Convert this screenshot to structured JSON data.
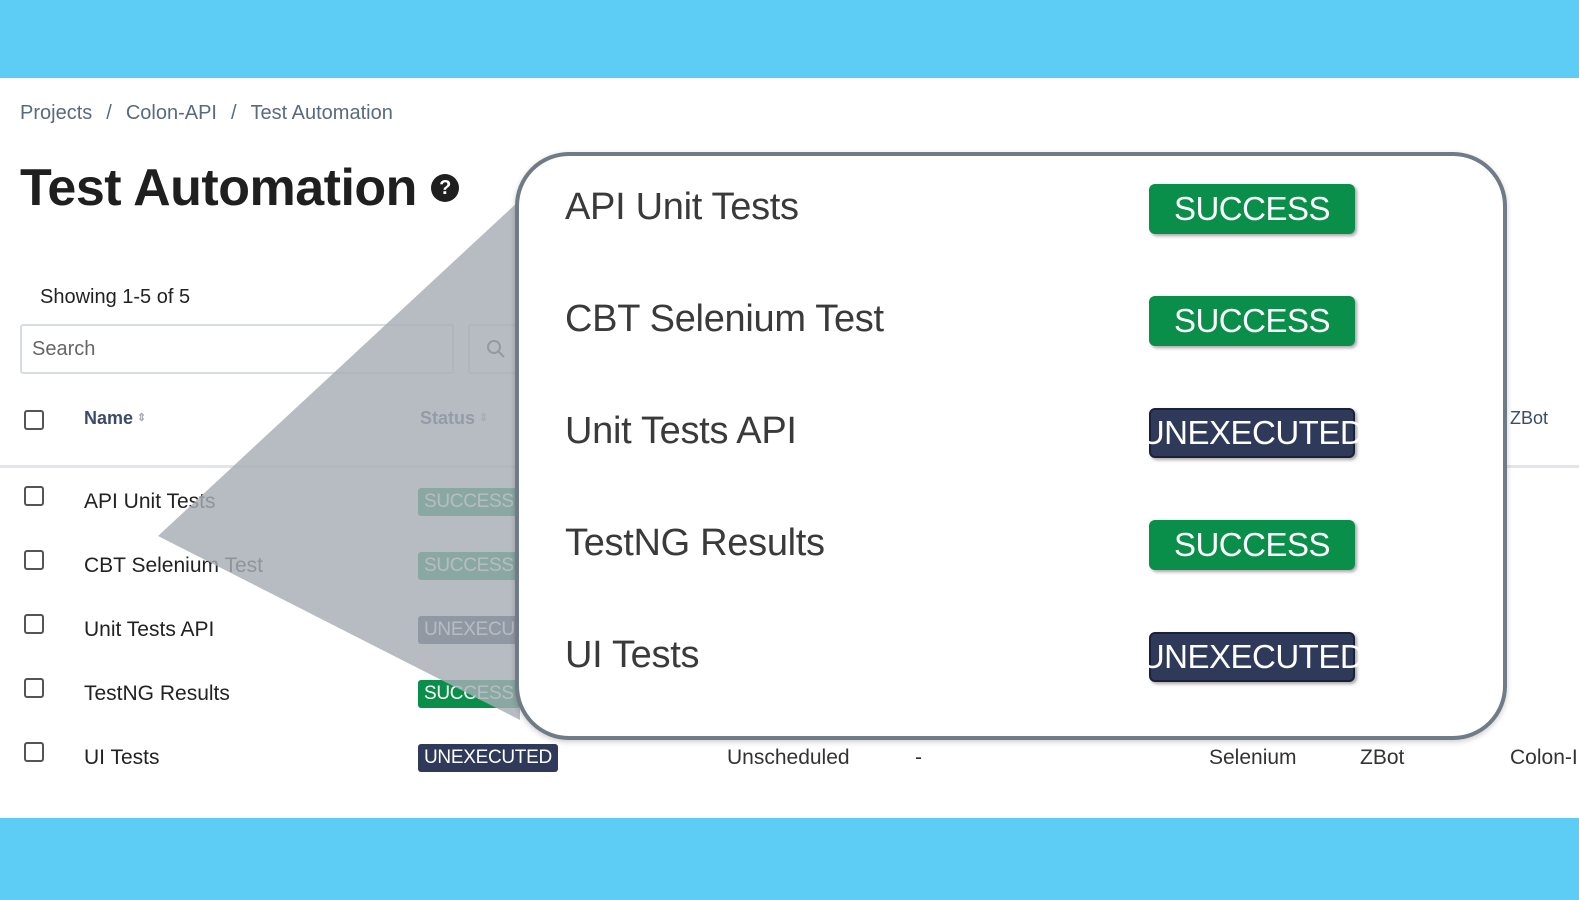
{
  "breadcrumb": {
    "projects": "Projects",
    "project": "Colon-API",
    "current": "Test Automation",
    "separator": "/"
  },
  "page": {
    "title": "Test Automation",
    "help_glyph": "?"
  },
  "list": {
    "showing": "Showing 1-5 of 5"
  },
  "search": {
    "placeholder": "Search"
  },
  "table": {
    "headers": {
      "name": "Name",
      "status": "Status",
      "framework_owner": "ZBot"
    },
    "rows": [
      {
        "name": "API Unit Tests",
        "status": "SUCCESS"
      },
      {
        "name": "CBT Selenium Test",
        "status": "SUCCESS"
      },
      {
        "name": "Unit Tests API",
        "status": "UNEXECUTED"
      },
      {
        "name": "TestNG Results",
        "status": "SUCCESS"
      },
      {
        "name": "UI Tests",
        "status": "UNEXECUTED",
        "schedule": "Unscheduled",
        "dash": "-",
        "framework": "Selenium",
        "owner": "ZBot",
        "project": "Colon-I"
      }
    ]
  },
  "zoom": {
    "rows": [
      {
        "name": "API Unit Tests",
        "status": "SUCCESS"
      },
      {
        "name": "CBT Selenium Test",
        "status": "SUCCESS"
      },
      {
        "name": "Unit Tests API",
        "status": "UNEXECUTED"
      },
      {
        "name": "TestNG Results",
        "status": "SUCCESS"
      },
      {
        "name": "UI Tests",
        "status": "UNEXECUTED"
      }
    ]
  },
  "colors": {
    "background_band": "#5ecdf5",
    "success": "#0a8f4a",
    "unexecuted": "#2f3a5a",
    "overlay": "#a6adb5"
  }
}
